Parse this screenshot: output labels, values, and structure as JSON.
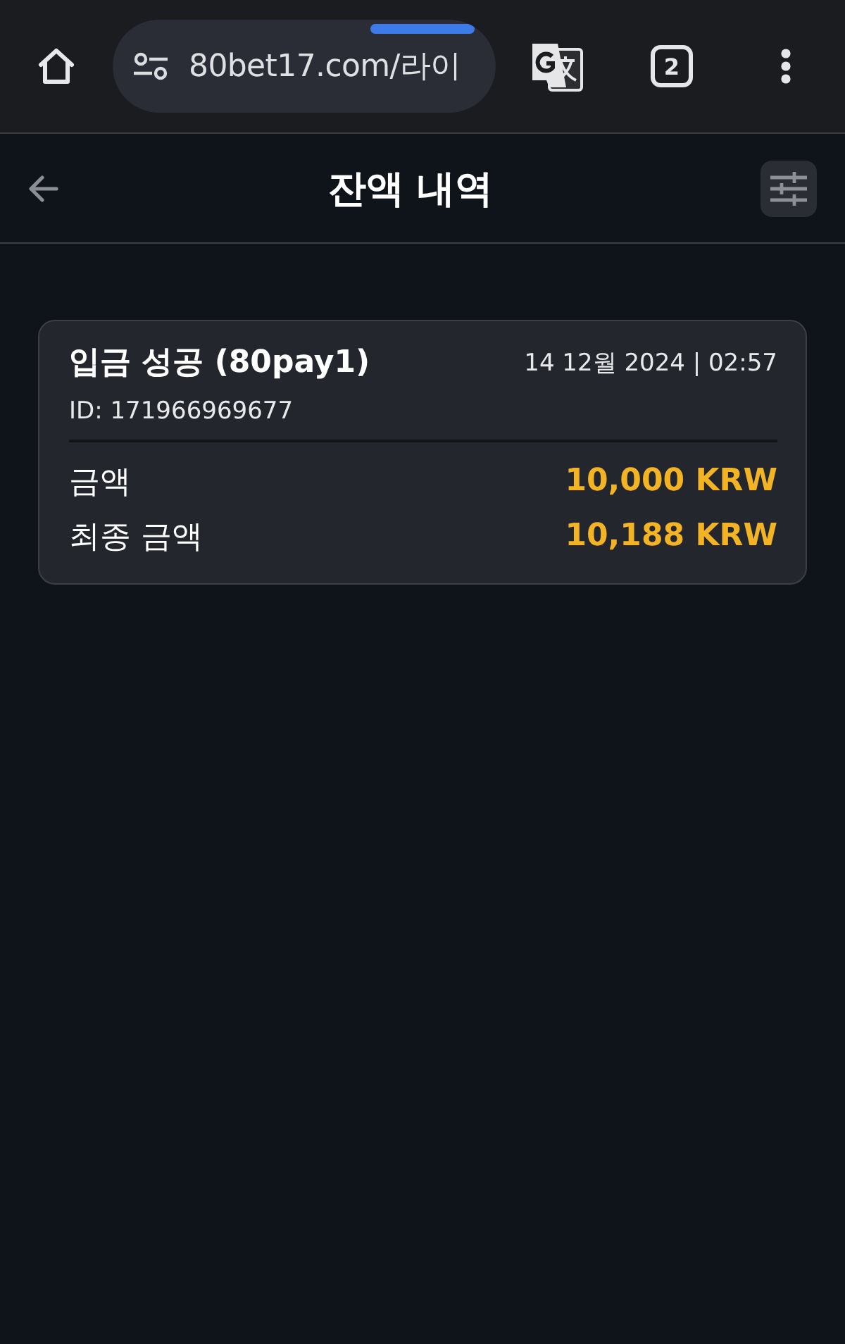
{
  "browser": {
    "url": "80bet17.com/라이",
    "tab_count": "2"
  },
  "header": {
    "title": "잔액 내역"
  },
  "transactions": [
    {
      "title": "입금 성공 (80pay1)",
      "date": "14 12월 2024 | 02:57",
      "id": "ID: 171966969677",
      "rows": [
        {
          "label": "금액",
          "value": "10,000 KRW"
        },
        {
          "label": "최종 금액",
          "value": "10,188 KRW"
        }
      ]
    }
  ]
}
